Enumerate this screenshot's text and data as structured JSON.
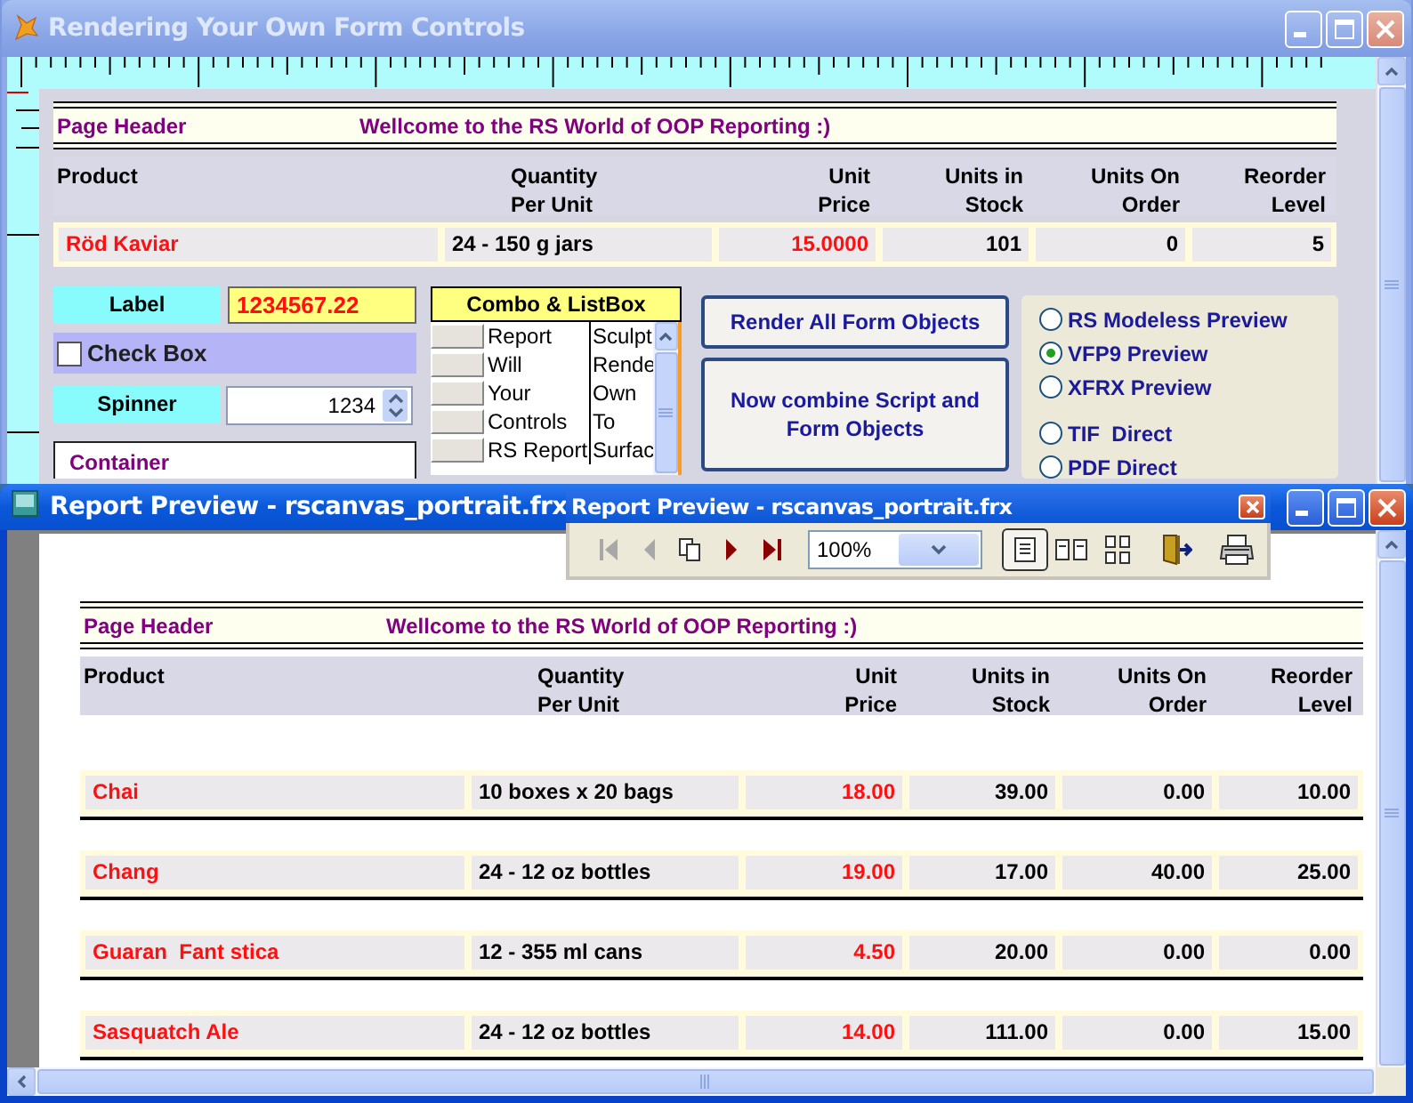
{
  "designer_window": {
    "title": "Rendering Your Own Form Controls",
    "page_header": {
      "label": "Page Header",
      "title": "Wellcome to the RS World of OOP Reporting :)"
    },
    "columns": [
      "Product",
      "Quantity\nPer Unit",
      "Unit\nPrice",
      "Units in\nStock",
      "Units On\nOrder",
      "Reorder\nLevel"
    ],
    "rows": [
      [
        "Röd Kaviar",
        "24 - 150 g jars",
        "15.0000",
        "101",
        "0",
        "5"
      ]
    ],
    "label_control": {
      "caption": "Label",
      "value": "1234567.22"
    },
    "checkbox": {
      "label": "Check Box",
      "checked": false
    },
    "spinner": {
      "caption": "Spinner",
      "value": "1234"
    },
    "container": {
      "caption": "Container"
    },
    "listbox": {
      "caption": "Combo & ListBox",
      "rows": [
        [
          "Report",
          "Sculpt"
        ],
        [
          "Will",
          "Rende"
        ],
        [
          "Your",
          "Own"
        ],
        [
          "Controls",
          "To"
        ],
        [
          "RS Report",
          "Surfac"
        ]
      ]
    },
    "buttons": [
      "Render All Form Objects",
      "Now combine Script and Form Objects"
    ],
    "radios": [
      {
        "label": "RS Modeless Preview",
        "selected": false
      },
      {
        "label": "VFP9 Preview",
        "selected": true
      },
      {
        "label": "XFRX Preview",
        "selected": false
      },
      {
        "label": "TIF  Direct",
        "selected": false
      },
      {
        "label": "PDF Direct",
        "selected": false
      }
    ]
  },
  "preview_window": {
    "title": "Report Preview - rscanvas_portrait.frx",
    "page_header": {
      "label": "Page Header",
      "title": "Wellcome to the RS World of OOP Reporting :)"
    },
    "columns": [
      "Product",
      "Quantity\nPer Unit",
      "Unit\nPrice",
      "Units in\nStock",
      "Units On\nOrder",
      "Reorder\nLevel"
    ],
    "rows": [
      [
        "Chai",
        "10 boxes x 20 bags",
        "18.00",
        "39.00",
        "0.00",
        "10.00"
      ],
      [
        "Chang",
        "24 - 12 oz bottles",
        "19.00",
        "17.00",
        "40.00",
        "25.00"
      ],
      [
        "Guaran  Fant stica",
        "12 - 355 ml cans",
        "4.50",
        "20.00",
        "0.00",
        "0.00"
      ],
      [
        "Sasquatch Ale",
        "24 - 12 oz bottles",
        "14.00",
        "111.00",
        "0.00",
        "15.00"
      ]
    ]
  },
  "preview_toolbar": {
    "title": "Report Preview - rscanvas_portrait.frx",
    "nav_buttons": [
      {
        "kind": "first",
        "disabled": true
      },
      {
        "kind": "prev",
        "disabled": true
      },
      {
        "kind": "copy",
        "disabled": false
      },
      {
        "kind": "next",
        "disabled": false
      },
      {
        "kind": "last",
        "disabled": false
      }
    ],
    "zoom": "100%",
    "view_buttons": [
      {
        "kind": "one-page",
        "selected": true
      },
      {
        "kind": "two-page",
        "selected": false
      },
      {
        "kind": "four-page",
        "selected": false
      }
    ],
    "action_buttons": [
      {
        "kind": "exit"
      },
      {
        "kind": "print"
      }
    ]
  }
}
